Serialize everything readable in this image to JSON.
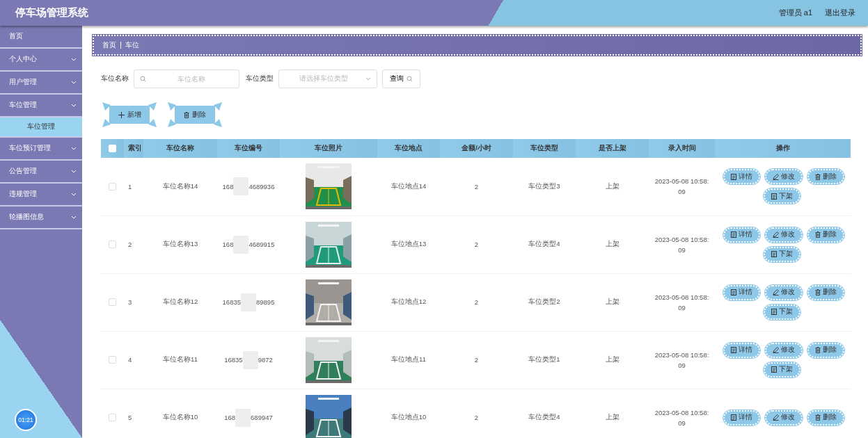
{
  "header": {
    "title": "停车场管理系统",
    "user": "管理员 a1",
    "logout": "退出登录"
  },
  "sidebar": {
    "items": [
      {
        "label": "首页",
        "expandable": false
      },
      {
        "label": "个人中心",
        "expandable": true
      },
      {
        "label": "用户管理",
        "expandable": true
      },
      {
        "label": "车位管理",
        "expandable": true,
        "expanded": true,
        "children": [
          {
            "label": "车位管理",
            "selected": true
          }
        ]
      },
      {
        "label": "车位预订管理",
        "expandable": true
      },
      {
        "label": "公告管理",
        "expandable": true
      },
      {
        "label": "违规管理",
        "expandable": true
      },
      {
        "label": "轮播图信息",
        "expandable": true
      }
    ],
    "clock": "01:21"
  },
  "breadcrumb": [
    "首页",
    "车位"
  ],
  "search": {
    "name_label": "车位名称",
    "name_placeholder": "车位名称",
    "type_label": "车位类型",
    "type_placeholder": "请选择车位类型",
    "query": "查询"
  },
  "toolbar": [
    {
      "kind": "add",
      "label": "新增"
    },
    {
      "kind": "delete",
      "label": "删除"
    }
  ],
  "table": {
    "columns": [
      "索引",
      "车位名称",
      "车位编号",
      "车位照片",
      "车位地点",
      "金额/小时",
      "车位类型",
      "是否上架",
      "录入时间",
      "操作"
    ],
    "header_checked": false,
    "rows": [
      {
        "checked": false,
        "index": "1",
        "name": "车位名称14",
        "code_start": "168",
        "code_end": "4689936",
        "photo": {
          "kind": "picture"
        },
        "location": "车位地点14",
        "price": "2",
        "type": "车位类型3",
        "shelf": "上架",
        "time": "2023-05-08 10:58:09",
        "actions": [
          {
            "kind": "detail",
            "label": "详情"
          },
          {
            "kind": "edit",
            "label": "修改"
          },
          {
            "kind": "delete",
            "label": "删除"
          },
          {
            "kind": "unshelf",
            "label": "下架"
          }
        ]
      },
      {
        "checked": false,
        "index": "2",
        "name": "车位名称13",
        "code_start": "168",
        "code_end": "4689915",
        "photo": {
          "kind": "picture"
        },
        "location": "车位地点13",
        "price": "2",
        "type": "车位类型4",
        "shelf": "上架",
        "time": "2023-05-08 10:58:09",
        "actions": [
          {
            "kind": "detail",
            "label": "详情"
          },
          {
            "kind": "edit",
            "label": "修改"
          },
          {
            "kind": "delete",
            "label": "删除"
          },
          {
            "kind": "unshelf",
            "label": "下架"
          }
        ]
      },
      {
        "checked": false,
        "index": "3",
        "name": "车位名称12",
        "code_start": "16835",
        "code_end": "89895",
        "photo": {
          "kind": "picture"
        },
        "location": "车位地点12",
        "price": "2",
        "type": "车位类型2",
        "shelf": "上架",
        "time": "2023-05-08 10:58:09",
        "actions": [
          {
            "kind": "detail",
            "label": "详情"
          },
          {
            "kind": "edit",
            "label": "修改"
          },
          {
            "kind": "delete",
            "label": "删除"
          },
          {
            "kind": "unshelf",
            "label": "下架"
          }
        ]
      },
      {
        "checked": false,
        "index": "4",
        "name": "车位名称11",
        "code_start": "16835",
        "code_end": "9872",
        "photo": {
          "kind": "picture"
        },
        "location": "车位地点11",
        "price": "2",
        "type": "车位类型1",
        "shelf": "上架",
        "time": "2023-05-08 10:58:09",
        "actions": [
          {
            "kind": "detail",
            "label": "详情"
          },
          {
            "kind": "edit",
            "label": "修改"
          },
          {
            "kind": "delete",
            "label": "删除"
          },
          {
            "kind": "unshelf",
            "label": "下架"
          }
        ]
      },
      {
        "checked": false,
        "index": "5",
        "name": "车位名称10",
        "code_start": "168",
        "code_end": "689947",
        "photo": {
          "kind": "picture"
        },
        "location": "车位地点10",
        "price": "2",
        "type": "车位类型4",
        "shelf": "上架",
        "time": "2023-05-08 10:58:09",
        "actions": [
          {
            "kind": "detail",
            "label": "详情"
          },
          {
            "kind": "edit",
            "label": "修改"
          },
          {
            "kind": "delete",
            "label": "删除"
          }
        ]
      }
    ]
  }
}
